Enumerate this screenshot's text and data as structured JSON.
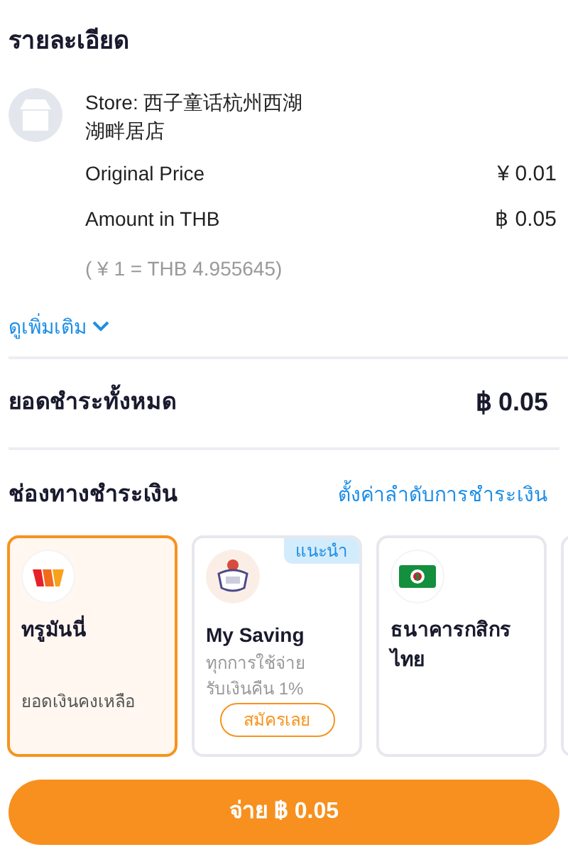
{
  "details": {
    "title": "รายละเอียด",
    "store": "Store: 西子童话杭州西湖湖畔居店",
    "rows": [
      {
        "label": "Original Price",
        "value": "¥ 0.01"
      },
      {
        "label": "Amount in THB",
        "value": "฿ 0.05"
      }
    ],
    "rate": "( ¥ 1 = THB 4.955645)",
    "more": "ดูเพิ่มเติม"
  },
  "total": {
    "label": "ยอดชำระทั้งหมด",
    "value": "฿ 0.05"
  },
  "methods": {
    "title": "ช่องทางชำระเงิน",
    "link": "ตั้งค่าลำดับการชำระเงิน",
    "cards": [
      {
        "kind": "wallet",
        "name": "ทรูมันนี่",
        "selected": true,
        "note": "ยอดเงินคงเหลือ"
      },
      {
        "kind": "promo",
        "name": "My Saving",
        "selected": false,
        "badge": "แนะนำ",
        "subtitle": "ทุกการใช้จ่าย\nรับเงินคืน 1%",
        "button": "สมัครเลย"
      },
      {
        "kind": "bank",
        "name": "ธนาคารกสิกรไทย",
        "selected": false
      }
    ]
  },
  "pay_button": "จ่าย ฿ 0.05"
}
